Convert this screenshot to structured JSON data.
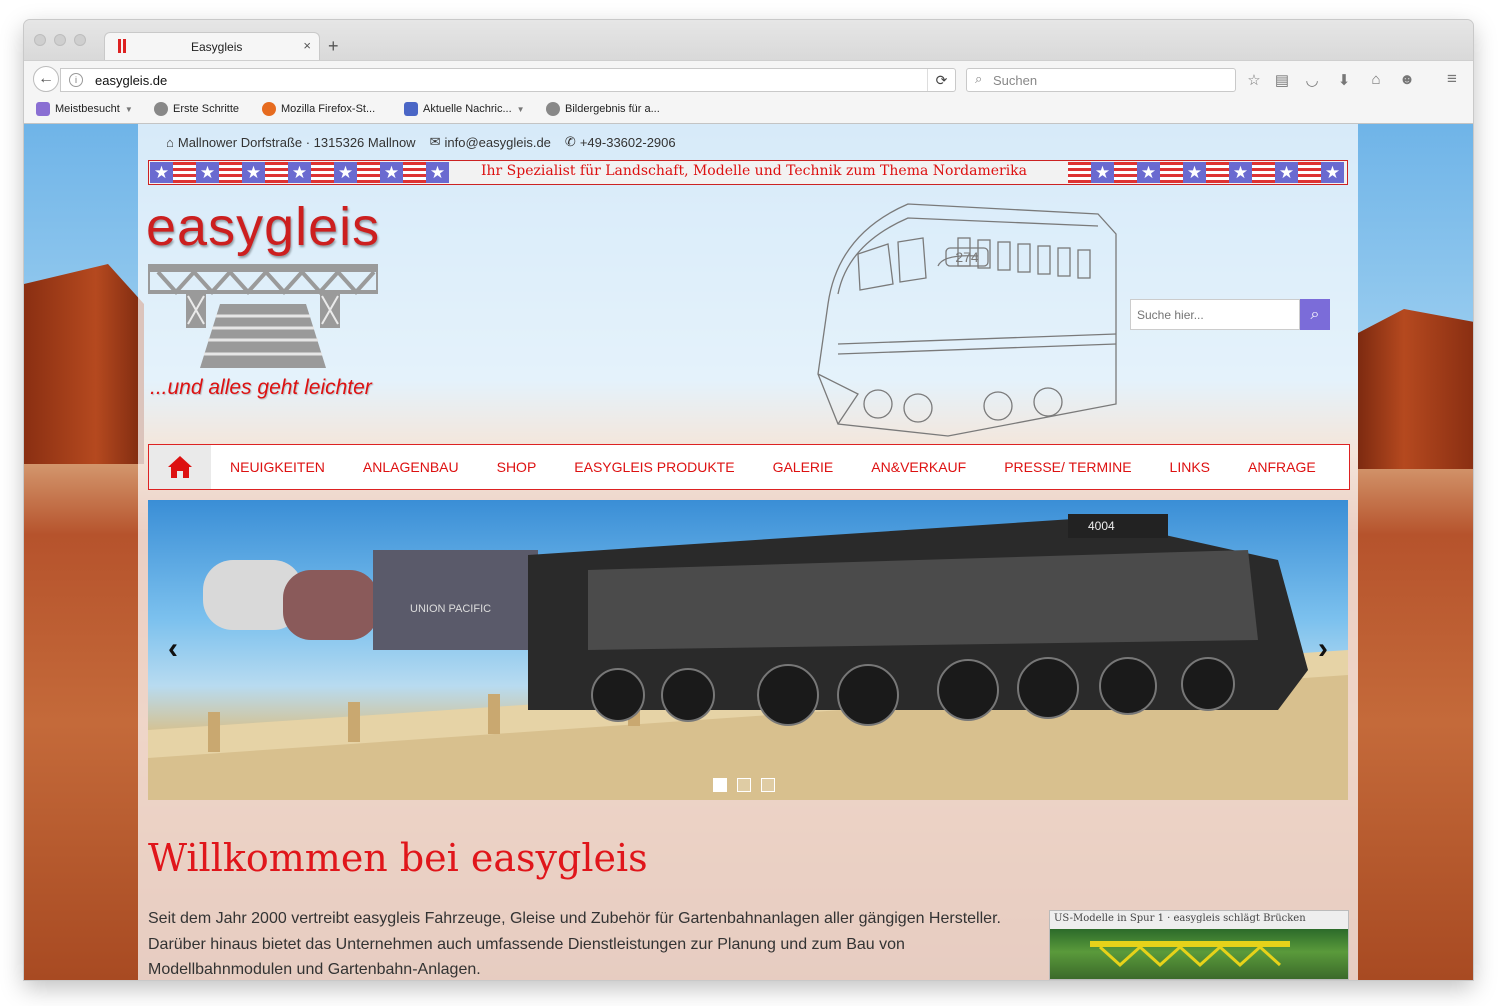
{
  "browser": {
    "tab_title": "Easygleis",
    "tab_close": "×",
    "new_tab": "+",
    "url": "easygleis.de",
    "search_placeholder": "Suchen",
    "bookmarks": [
      {
        "label": "Meistbesucht",
        "dropdown": true
      },
      {
        "label": "Erste Schritte"
      },
      {
        "label": "Mozilla Firefox-St..."
      },
      {
        "label": "Aktuelle Nachric...",
        "dropdown": true
      },
      {
        "label": "Bildergebnis für a..."
      }
    ]
  },
  "site": {
    "address": "Mallnower Dorfstraße · 1315326 Mallnow",
    "email": "info@easygleis.de",
    "phone": "+49-33602-2906",
    "banner_text": "Ihr Spezialist für Landschaft, Modelle und Technik zum Thema Nordamerika",
    "logo_text": "easygleis",
    "tagline": "...und alles geht leichter",
    "locomotive_number": "274",
    "search_placeholder": "Suche hier...",
    "nav": [
      "NEUIGKEITEN",
      "ANLAGENBAU",
      "SHOP",
      "EASYGLEIS PRODUKTE",
      "GALERIE",
      "AN&VERKAUF",
      "PRESSE/ TERMINE",
      "LINKS",
      "ANFRAGE"
    ],
    "slider": {
      "prev": "‹",
      "next": "›",
      "slides": 3,
      "active": 1,
      "loco_label": "UNION PACIFIC",
      "loco_number": "4004"
    },
    "welcome_title": "Willkommen bei easygleis",
    "intro": "Seit dem Jahr 2000 vertreibt easygleis Fahrzeuge, Gleise und Zubehör für Gartenbahnanlagen aller gängigen Hersteller. Darüber hinaus bietet das Unternehmen auch umfassende Dienstleistungen zur Planung und zum Bau von Modellbahnmodulen und Gartenbahn-Anlagen.",
    "promo_text": "US-Modelle in Spur 1 · easygleis schlägt Brücken"
  },
  "colors": {
    "brand_red": "#cc1f1f",
    "accent_purple": "#7b6cd9"
  }
}
